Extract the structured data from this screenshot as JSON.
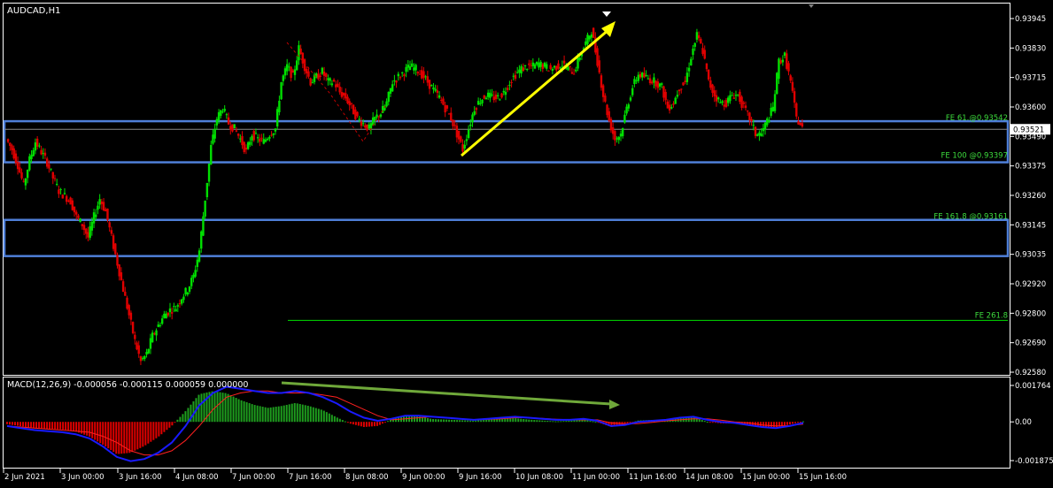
{
  "window": {
    "symbol_title": "AUDCAD,H1"
  },
  "colors": {
    "background": "#000000",
    "frame": "#ffffff",
    "bull": "#00e000",
    "bear": "#e00000",
    "zone_border": "#4f7fd8",
    "fib_text": "#3ddc3d",
    "yellow_arrow": "#ffff00",
    "macd_arrow": "#6fa83a",
    "macd_line": "#1a1aff",
    "signal_line": "#ff2020",
    "hist_pos": "#1e9e1e",
    "hist_neg": "#e00000"
  },
  "price_axis": {
    "labels": [
      "0.93945",
      "0.93830",
      "0.93715",
      "0.93600",
      "0.93490",
      "0.93375",
      "0.93260",
      "0.93145",
      "0.93035",
      "0.92920",
      "0.92800",
      "0.92690",
      "0.92580"
    ],
    "current_price": "0.93521"
  },
  "fib_levels": [
    {
      "label": "FE 61.@0.93542",
      "price": 0.93542
    },
    {
      "label": "FE 100 @0.93397",
      "price": 0.93397
    },
    {
      "label": "FE 161.8 @0.93161",
      "price": 0.93161
    },
    {
      "label": "FE 261.8",
      "price": 0.9278
    }
  ],
  "macd": {
    "label": "MACD(12,26,9) -0.000056 -0.000115 0.000059 0.000000",
    "axis_labels": [
      "0.001764",
      "0.00",
      "-0.001875"
    ]
  },
  "time_axis": {
    "labels": [
      "2 Jun 2021",
      "3 Jun 00:00",
      "3 Jun 16:00",
      "4 Jun 08:00",
      "7 Jun 00:00",
      "7 Jun 16:00",
      "8 Jun 08:00",
      "9 Jun 00:00",
      "9 Jun 16:00",
      "10 Jun 08:00",
      "11 Jun 00:00",
      "11 Jun 16:00",
      "14 Jun 08:00",
      "15 Jun 00:00",
      "15 Jun 16:00"
    ]
  },
  "chart_data": {
    "type": "candlestick",
    "symbol": "AUDCAD",
    "timeframe": "H1",
    "close_path": [
      0.9348,
      0.9344,
      0.9338,
      0.933,
      0.934,
      0.9347,
      0.9343,
      0.9339,
      0.9333,
      0.9328,
      0.9326,
      0.9324,
      0.9318,
      0.9315,
      0.931,
      0.9318,
      0.9325,
      0.932,
      0.931,
      0.93,
      0.929,
      0.928,
      0.927,
      0.9262,
      0.9265,
      0.9272,
      0.9276,
      0.928,
      0.9282,
      0.9283,
      0.9287,
      0.929,
      0.9295,
      0.9305,
      0.9325,
      0.9345,
      0.9356,
      0.936,
      0.9354,
      0.9352,
      0.9348,
      0.9343,
      0.935,
      0.9348,
      0.9347,
      0.935,
      0.9352,
      0.937,
      0.9376,
      0.9372,
      0.9383,
      0.9376,
      0.937,
      0.9372,
      0.9374,
      0.937,
      0.937,
      0.9366,
      0.9364,
      0.936,
      0.9356,
      0.9354,
      0.9352,
      0.9356,
      0.9358,
      0.9362,
      0.937,
      0.9372,
      0.9374,
      0.9376,
      0.9375,
      0.9373,
      0.937,
      0.9367,
      0.9364,
      0.936,
      0.9356,
      0.935,
      0.9344,
      0.9352,
      0.936,
      0.9363,
      0.9365,
      0.9364,
      0.9364,
      0.9366,
      0.937,
      0.9373,
      0.9375,
      0.9376,
      0.9376,
      0.9377,
      0.9376,
      0.9375,
      0.9376,
      0.9377,
      0.9375,
      0.9374,
      0.938,
      0.9385,
      0.939,
      0.9378,
      0.9365,
      0.9355,
      0.9348,
      0.935,
      0.936,
      0.9368,
      0.9373,
      0.9372,
      0.9371,
      0.937,
      0.9368,
      0.936,
      0.9362,
      0.9368,
      0.937,
      0.938,
      0.9388,
      0.9382,
      0.937,
      0.9365,
      0.9362,
      0.9362,
      0.9365,
      0.9365,
      0.936,
      0.9356,
      0.935,
      0.935,
      0.9355,
      0.936,
      0.9378,
      0.938,
      0.937,
      0.9356,
      0.93521
    ],
    "ylim": [
      0.9255,
      0.94
    ],
    "macd_line": [
      -0.0002,
      -0.0003,
      -0.0004,
      -0.00045,
      -0.0005,
      -0.0006,
      -0.0008,
      -0.0012,
      -0.0017,
      -0.0019,
      -0.0018,
      -0.0015,
      -0.001,
      -0.0002,
      0.0008,
      0.0014,
      0.0017,
      0.0016,
      0.0015,
      0.0014,
      0.0014,
      0.0015,
      0.0014,
      0.0012,
      0.0009,
      0.0005,
      0.0002,
      5e-05,
      0.00015,
      0.0003,
      0.0003,
      0.00025,
      0.0002,
      0.00015,
      0.0001,
      0.00015,
      0.0002,
      0.00025,
      0.0002,
      0.00015,
      0.0001,
      0.0001,
      0.00015,
      5e-05,
      -0.0002,
      -0.00015,
      0.0,
      5e-05,
      0.0001,
      0.0002,
      0.00025,
      0.0001,
      0.0,
      -5e-05,
      -0.00015,
      -0.00025,
      -0.0003,
      -0.0002,
      -5e-05
    ],
    "signal_line": [
      -0.0002,
      -0.00025,
      -0.0003,
      -0.00035,
      -0.0004,
      -0.00045,
      -0.0005,
      -0.0007,
      -0.001,
      -0.0014,
      -0.0016,
      -0.0016,
      -0.0014,
      -0.0009,
      -0.0002,
      0.0006,
      0.0012,
      0.0014,
      0.0015,
      0.0015,
      0.0014,
      0.0014,
      0.0014,
      0.0013,
      0.0012,
      0.0009,
      0.0006,
      0.0003,
      0.0001,
      0.00015,
      0.0002,
      0.00025,
      0.0002,
      0.00015,
      0.0001,
      0.00012,
      0.00015,
      0.0002,
      0.0002,
      0.00017,
      0.00013,
      0.0001,
      0.0001,
      0.0001,
      -5e-05,
      -0.0001,
      -8e-05,
      -2e-05,
      5e-05,
      0.0001,
      0.00015,
      0.00015,
      8e-05,
      0.0,
      -5e-05,
      -0.00015,
      -0.0002,
      -0.00018,
      -0.00011
    ],
    "macd_ylim": [
      -0.001875,
      0.001764
    ]
  }
}
